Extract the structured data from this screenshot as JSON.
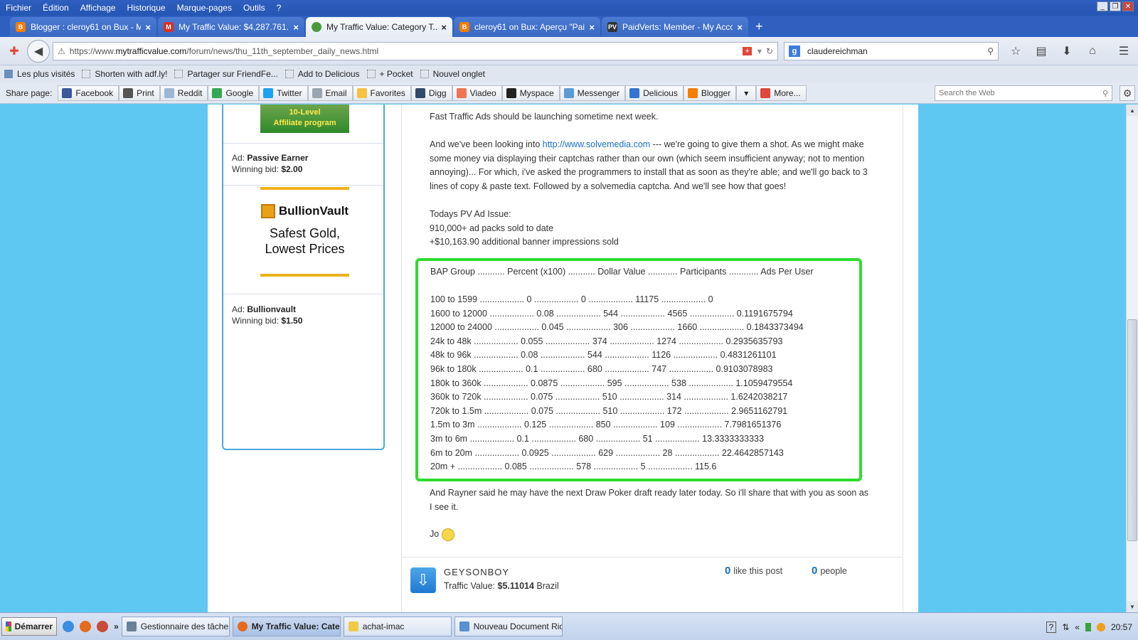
{
  "menu": [
    "Fichier",
    "Édition",
    "Affichage",
    "Historique",
    "Marque-pages",
    "Outils",
    "?"
  ],
  "tabs": [
    {
      "title": "Blogger : cleroy61 on Bux - M...",
      "icon": "blogger-icon",
      "color": "#f57d00"
    },
    {
      "title": "My Traffic Value: $4,287.761...",
      "icon": "gmail-icon",
      "color": "#d93025"
    },
    {
      "title": "My Traffic Value: Category T...",
      "icon": "globe-icon",
      "color": "#4a9a3a"
    },
    {
      "title": "cleroy61 on Bux: Aperçu \"Pai...",
      "icon": "blogger-icon",
      "color": "#f57d00"
    },
    {
      "title": "PaidVerts: Member - My Acco...",
      "icon": "paidverts-icon",
      "color": "#333333"
    }
  ],
  "url": {
    "prefix": "https://www.",
    "domain": "mytrafficvalue.com",
    "path": "/forum/news/thu_11th_september_daily_news.html"
  },
  "search": {
    "value": "claudereichman"
  },
  "bookmarks": [
    "Les plus visités",
    "Shorten with adf.ly!",
    "Partager sur FriendFe...",
    "Add to Delicious",
    "+ Pocket",
    "Nouvel onglet"
  ],
  "sharebar": {
    "label": "Share page:",
    "buttons": [
      {
        "label": "Facebook",
        "color": "#3b5998"
      },
      {
        "label": "Print",
        "color": "#555555"
      },
      {
        "label": "Reddit",
        "color": "#9bb7d4"
      },
      {
        "label": "Google",
        "color": "#34a853"
      },
      {
        "label": "Twitter",
        "color": "#1da1f2"
      },
      {
        "label": "Email",
        "color": "#9aa4b0"
      },
      {
        "label": "Favorites",
        "color": "#f5c242"
      },
      {
        "label": "Digg",
        "color": "#314b6a"
      },
      {
        "label": "Viadeo",
        "color": "#f07355"
      },
      {
        "label": "Myspace",
        "color": "#222222"
      },
      {
        "label": "Messenger",
        "color": "#5a9bd5"
      },
      {
        "label": "Delicious",
        "color": "#3274d1"
      },
      {
        "label": "Blogger",
        "color": "#f57d00"
      },
      {
        "label": "More...",
        "color": "#e0463a"
      }
    ],
    "search_placeholder": "Search the Web"
  },
  "sidebar": {
    "ad1_banner_line1": "10-Level",
    "ad1_banner_line2": "Affiliate program",
    "ad1_name": "Passive Earner",
    "ad1_bid": "$2.00",
    "bv_logo": "BullionVault",
    "bv_line1": "Safest Gold,",
    "bv_line2": "Lowest Prices",
    "ad2_name": "Bullionvault",
    "ad2_bid": "$1.50",
    "ad_prefix": "Ad: ",
    "bid_prefix": "Winning bid: "
  },
  "post": {
    "p1": "Fast Traffic Ads should be launching sometime next week.",
    "p2_before": "And we've been looking into ",
    "p2_link": "http://www.solvemedia.com",
    "p2_after": " --- we're going to give them a shot. As we might make some money via displaying their captchas rather than our own (which seem insufficient anyway; not to mention annoying)... For which, i've asked the programmers to install that as soon as they're able; and we'll go back to 3 lines of copy & paste text. Followed by a solvemedia captcha. And we'll see how that goes!",
    "issue_title": "Todays PV Ad Issue:",
    "issue_l1": "910,000+ ad packs sold to date",
    "issue_l2": "+$10,163.90 additional banner impressions sold",
    "table_header": "BAP Group ........... Percent (x100) ........... Dollar Value ............ Participants ............ Ads Per User",
    "table_rows": [
      "100 to 1599 .................. 0 .................. 0 .................. 11175 .................. 0",
      "1600 to 12000 .................. 0.08 .................. 544 .................. 4565 .................. 0.1191675794",
      "12000 to 24000 .................. 0.045 .................. 306 .................. 1660 .................. 0.1843373494",
      "24k to 48k .................. 0.055 .................. 374 .................. 1274 .................. 0.2935635793",
      "48k to 96k .................. 0.08 .................. 544 .................. 1126 .................. 0.4831261101",
      "96k to 180k .................. 0.1 .................. 680 .................. 747 .................. 0.9103078983",
      "180k to 360k .................. 0.0875 .................. 595 .................. 538 .................. 1.1059479554",
      "360k to 720k .................. 0.075 .................. 510 .................. 314 .................. 1.6242038217",
      "720k to 1.5m .................. 0.075 .................. 510 .................. 172 .................. 2.9651162791",
      "1.5m to 3m .................. 0.125 .................. 850 .................. 109 .................. 7.7981651376",
      "3m to 6m .................. 0.1 .................. 680 .................. 51 .................. 13.3333333333",
      "6m to 20m .................. 0.0925 .................. 629 .................. 28 .................. 22.4642857143",
      "20m + .................. 0.085 .................. 578 .................. 5 .................. 115.6"
    ],
    "p3": "And Rayner said he may have the next Draw Poker draft ready later today. So i'll share that with you as soon as I see it.",
    "signature": "Jo"
  },
  "footer": {
    "poster": "GEYSONBOY",
    "value_label": "Traffic Value: ",
    "value_amount": "$5.11014",
    "country": " Brazil",
    "likes_count": "0",
    "likes_label": "like this post",
    "people_count": "0",
    "people_label": "people"
  },
  "taskbar": {
    "start": "Démarrer",
    "tasks": [
      {
        "label": "Gestionnaire des tâches ...",
        "active": false
      },
      {
        "label": "My Traffic Value: Cate...",
        "active": true
      },
      {
        "label": "achat-imac",
        "active": false
      },
      {
        "label": "Nouveau Document Rich ...",
        "active": false
      }
    ],
    "clock": "20:57"
  }
}
